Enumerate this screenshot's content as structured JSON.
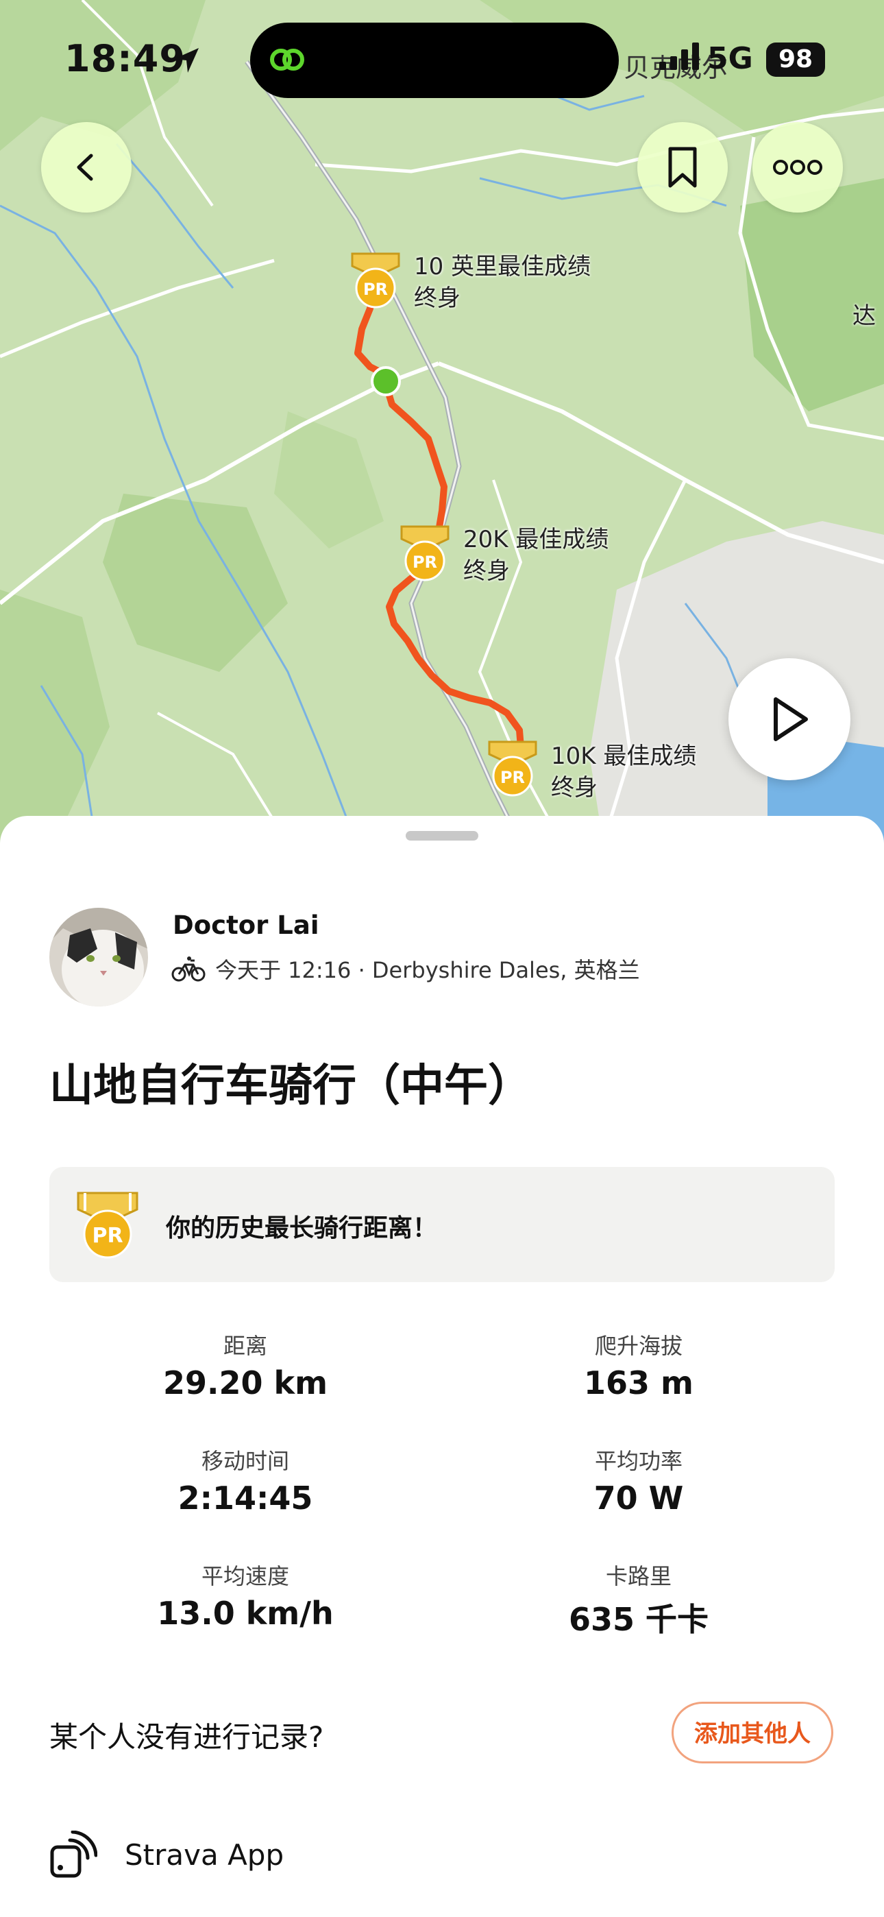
{
  "status_bar": {
    "time": "18:49",
    "carrier_partial": "贝克威尔",
    "network": "5G",
    "battery": "98"
  },
  "map": {
    "edge_label": "达",
    "pr_markers": [
      {
        "badge": "PR",
        "line1": "10 英里最佳成绩",
        "line2": "终身"
      },
      {
        "badge": "PR",
        "line1": "20K 最佳成绩",
        "line2": "终身"
      },
      {
        "badge": "PR",
        "line1": "10K 最佳成绩",
        "line2": "终身"
      }
    ],
    "colors": {
      "route": "#f0541e",
      "start_dot": "#5cc02a",
      "land": "#c8dfb0",
      "water": "#76b4e6"
    }
  },
  "activity": {
    "athlete_name": "Doctor Lai",
    "meta": "今天于 12:16 · Derbyshire Dales, 英格兰",
    "title": "山地自行车骑行（中午）",
    "pr_banner": {
      "badge": "PR",
      "text": "你的历史最长骑行距离！"
    },
    "stats": [
      {
        "label": "距离",
        "value": "29.20 km"
      },
      {
        "label": "爬升海拔",
        "value": "163 m"
      },
      {
        "label": "移动时间",
        "value": "2:14:45"
      },
      {
        "label": "平均功率",
        "value": "70 W"
      },
      {
        "label": "平均速度",
        "value": "13.0 km/h"
      },
      {
        "label": "卡路里",
        "value": "635 千卡"
      }
    ],
    "question": "某个人没有进行记录?",
    "add_others_label": "添加其他人",
    "device_label": "Strava App"
  },
  "icons": [
    "location-arrow-icon",
    "app-link-icon",
    "back-icon",
    "bookmark-icon",
    "more-icon",
    "play-icon",
    "pr-badge-icon",
    "bike-icon",
    "device-icon"
  ],
  "accent_color": "#e8581c"
}
